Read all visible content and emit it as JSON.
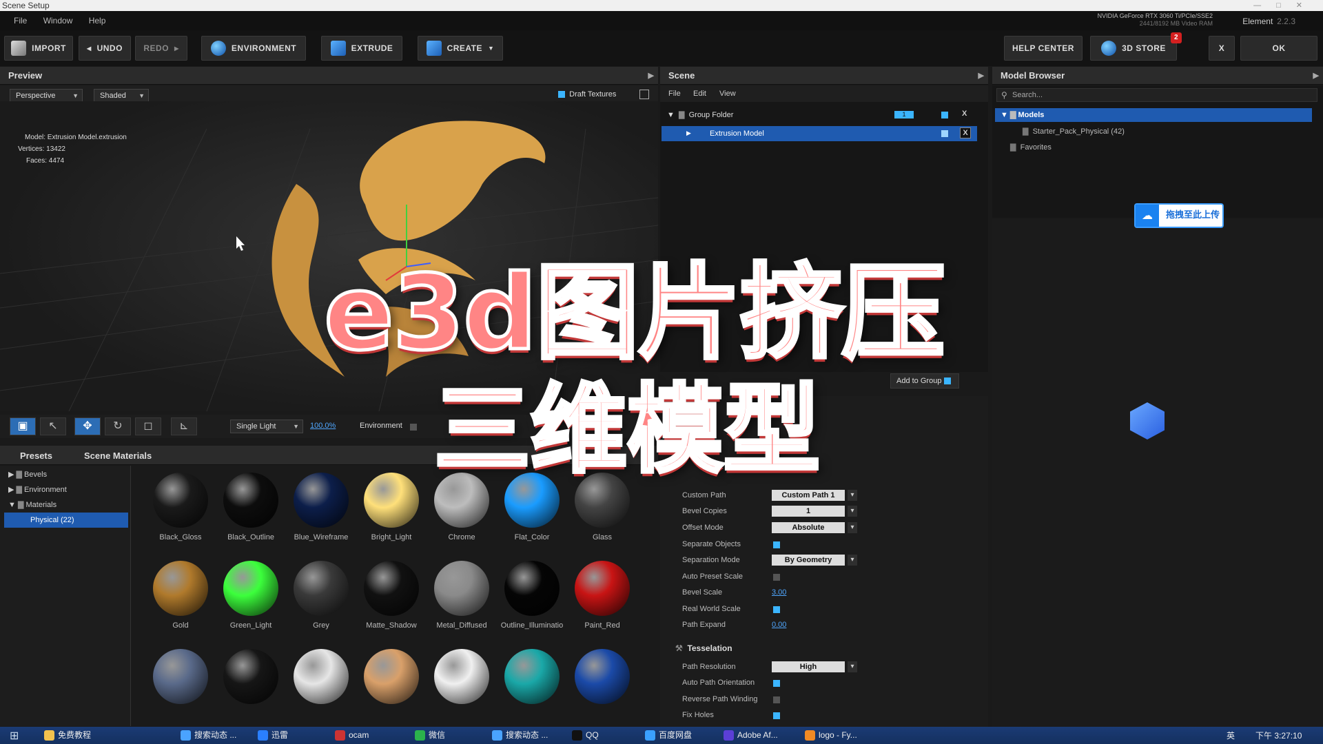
{
  "window": {
    "title": "Scene Setup"
  },
  "menu": [
    "File",
    "Window",
    "Help"
  ],
  "gpu_info": {
    "line1": "NVIDIA GeForce RTX 3060 Ti/PCIe/SSE2",
    "line2": "2441/8192 MB Video RAM"
  },
  "element": {
    "name": "Element",
    "version": "2.2.3"
  },
  "toolbar": {
    "import": "IMPORT",
    "undo": "UNDO",
    "redo": "REDO",
    "environment": "ENVIRONMENT",
    "extrude": "EXTRUDE",
    "create": "CREATE",
    "help_center": "HELP CENTER",
    "store": "3D STORE",
    "store_badge": "2",
    "close": "X",
    "ok": "OK"
  },
  "preview": {
    "title": "Preview",
    "camera": "Perspective",
    "shading": "Shaded",
    "draft_textures": "Draft Textures",
    "info": {
      "model_label": "Model:",
      "model": "Extrusion Model.extrusion",
      "vertices_label": "Vertices:",
      "vertices": "13422",
      "faces_label": "Faces:",
      "faces": "4474"
    },
    "light_mode": "Single Light",
    "light_percent": "100.0%",
    "environment_label": "Environment"
  },
  "scene": {
    "title": "Scene",
    "menu": [
      "File",
      "Edit",
      "View"
    ],
    "group_folder": "Group Folder",
    "group_count": "1",
    "extrusion_model": "Extrusion Model",
    "add_to_group": "Add to Group"
  },
  "model_browser": {
    "title": "Model Browser",
    "search_placeholder": "Search...",
    "models": "Models",
    "starter_pack": "Starter_Pack_Physical (42)",
    "favorites": "Favorites",
    "upload_label": "拖拽至此上传"
  },
  "presets": {
    "tab_presets": "Presets",
    "tab_scene_materials": "Scene Materials",
    "tree": {
      "bevels": "Bevels",
      "environment": "Environment",
      "materials": "Materials",
      "physical": "Physical (22)"
    },
    "materials": [
      {
        "name": "Black_Gloss",
        "color": "#1a1a1a"
      },
      {
        "name": "Black_Outline",
        "color": "#0d0d0d"
      },
      {
        "name": "Blue_Wireframe",
        "color": "#0c1e4a"
      },
      {
        "name": "Bright_Light",
        "color": "#ffe07a"
      },
      {
        "name": "Chrome",
        "color": "#bdbdbd"
      },
      {
        "name": "Flat_Color",
        "color": "#1a9cff"
      },
      {
        "name": "Glass",
        "color": "#444444"
      },
      {
        "name": "Gold",
        "color": "#b07a2c"
      },
      {
        "name": "Green_Light",
        "color": "#3cff3c"
      },
      {
        "name": "Grey",
        "color": "#3a3a3a"
      },
      {
        "name": "Matte_Shadow",
        "color": "#111111"
      },
      {
        "name": "Metal_Diffused",
        "color": "#8a8a8a"
      },
      {
        "name": "Outline_Illuminatio",
        "color": "#050505"
      },
      {
        "name": "Paint_Red",
        "color": "#c81414"
      },
      {
        "name": "",
        "color": "#5a6a8a"
      },
      {
        "name": "",
        "color": "#161616"
      },
      {
        "name": "",
        "color": "#e6e6e6"
      },
      {
        "name": "",
        "color": "#d9a06a"
      },
      {
        "name": "",
        "color": "#f0f0f0"
      },
      {
        "name": "",
        "color": "#1aa8a8"
      },
      {
        "name": "",
        "color": "#1b4aa8"
      }
    ]
  },
  "properties": {
    "custom_path_label": "Custom Path",
    "custom_path": "Custom Path 1",
    "bevel_copies_label": "Bevel Copies",
    "bevel_copies": "1",
    "offset_mode_label": "Offset Mode",
    "offset_mode": "Absolute",
    "separate_objects_label": "Separate Objects",
    "separation_mode_label": "Separation Mode",
    "separation_mode": "By Geometry",
    "auto_preset_scale_label": "Auto Preset Scale",
    "bevel_scale_label": "Bevel Scale",
    "bevel_scale": "3.00",
    "real_world_scale_label": "Real World Scale",
    "path_expand_label": "Path Expand",
    "path_expand": "0.00",
    "tesselation_title": "Tesselation",
    "path_resolution_label": "Path Resolution",
    "path_resolution": "High",
    "auto_path_orientation_label": "Auto Path Orientation",
    "reverse_path_winding_label": "Reverse Path Winding",
    "fix_holes_label": "Fix Holes"
  },
  "overlay": {
    "line1": "e3d图片挤压",
    "line2": "三维模型"
  },
  "taskbar": {
    "items": [
      "免费教程",
      "搜索动态 ...",
      "迅雷",
      "ocam",
      "微信",
      "搜索动态 ...",
      "QQ",
      "百度网盘",
      "Adobe Af...",
      "logo - Fy..."
    ],
    "lang": "英",
    "clock": "下午 3:27:10"
  }
}
